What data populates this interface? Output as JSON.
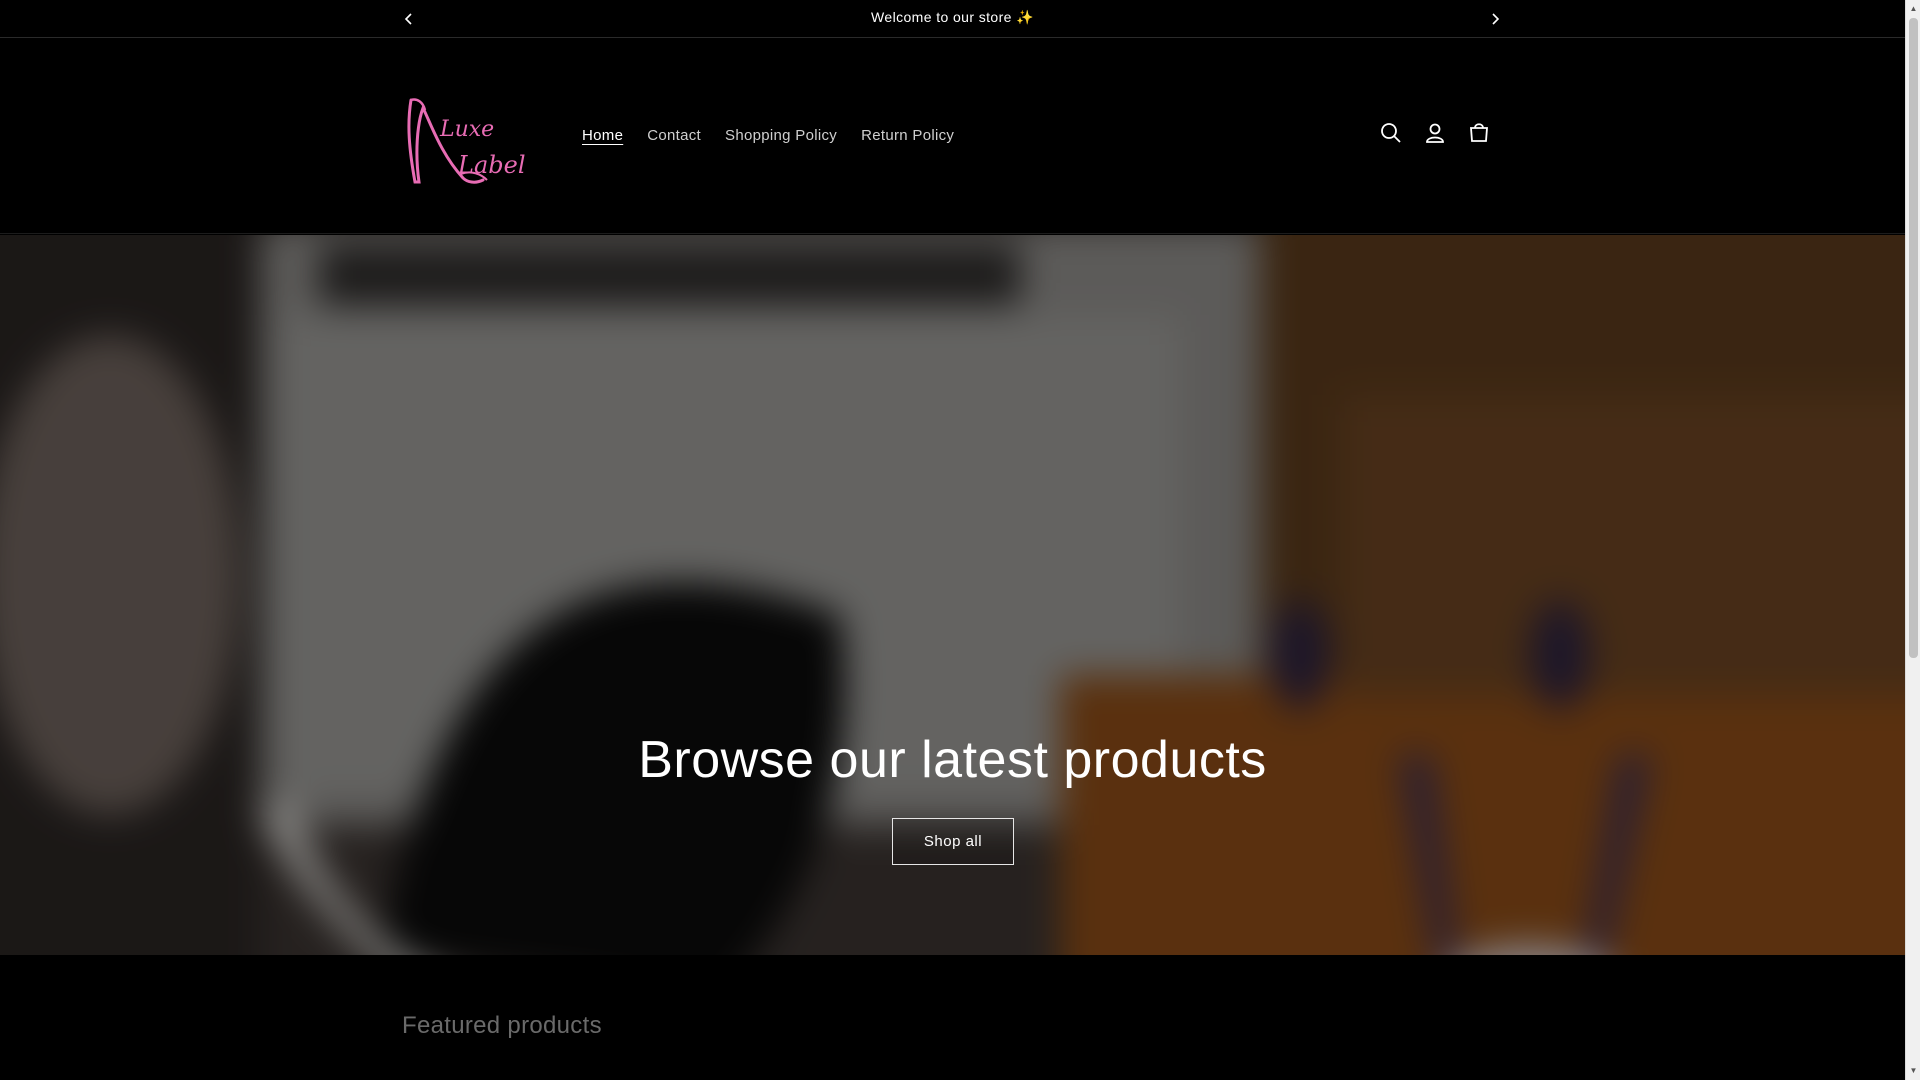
{
  "announcement": {
    "message": "Welcome to our store ✨",
    "prev_icon": "chevron-left-icon",
    "next_icon": "chevron-right-icon"
  },
  "header": {
    "logo": {
      "text_line1": "Luxe",
      "text_line2": "Label",
      "color": "#e86cb4"
    },
    "nav": [
      {
        "label": "Home",
        "active": true
      },
      {
        "label": "Contact",
        "active": false
      },
      {
        "label": "Shopping Policy",
        "active": false
      },
      {
        "label": "Return Policy",
        "active": false
      }
    ],
    "icons": [
      "search-icon",
      "account-icon",
      "cart-icon"
    ]
  },
  "hero": {
    "title": "Browse our latest products",
    "button_label": "Shop all"
  },
  "featured": {
    "title": "Featured products"
  },
  "colors": {
    "background": "#000000",
    "text": "#ffffff",
    "nav_text": "#cfcfcf",
    "muted_heading": "#6a6a6a",
    "brand_pink": "#e86cb4"
  }
}
